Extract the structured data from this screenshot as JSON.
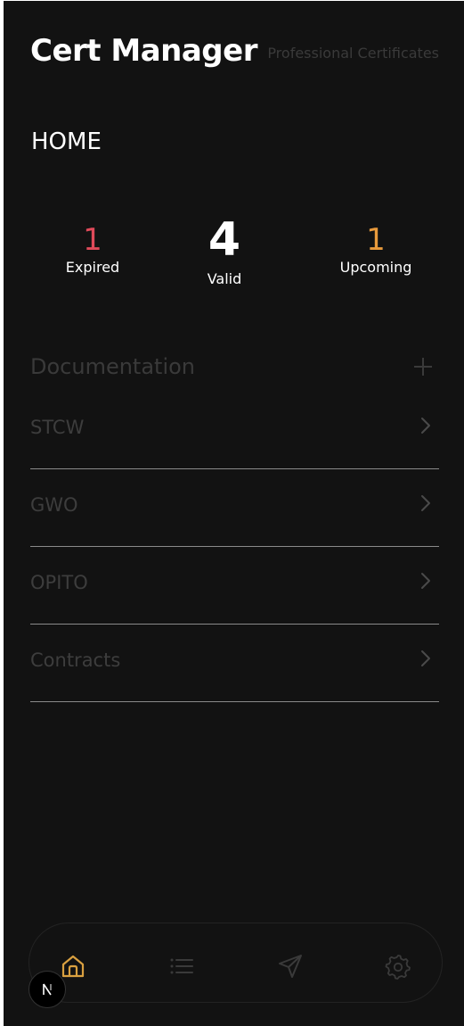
{
  "header": {
    "title": "Cert Manager",
    "subtitle": "Professional Certificates"
  },
  "page": {
    "title": "HOME"
  },
  "stats": {
    "expired": {
      "value": "1",
      "label": "Expired",
      "color": "#e04a5a"
    },
    "valid": {
      "value": "4",
      "label": "Valid",
      "color": "#ffffff"
    },
    "upcoming": {
      "value": "1",
      "label": "Upcoming",
      "color": "#e89a3c"
    }
  },
  "documentation": {
    "title": "Documentation",
    "add_icon": "plus-icon",
    "items": [
      {
        "label": "STCW",
        "icon": "chevron-right-icon"
      },
      {
        "label": "GWO",
        "icon": "chevron-right-icon"
      },
      {
        "label": "OPITO",
        "icon": "chevron-right-icon"
      },
      {
        "label": "Contracts",
        "icon": "chevron-right-icon"
      }
    ]
  },
  "bottom_nav": {
    "items": [
      {
        "name": "home",
        "icon": "home-icon",
        "active": true,
        "color": "#d9a040"
      },
      {
        "name": "list",
        "icon": "list-icon",
        "active": false,
        "color": "#3a3a3a"
      },
      {
        "name": "send",
        "icon": "send-icon",
        "active": false,
        "color": "#3a3a3a"
      },
      {
        "name": "settings",
        "icon": "gear-icon",
        "active": false,
        "color": "#3a3a3a"
      }
    ]
  },
  "colors": {
    "background": "#121212",
    "accent": "#d9a040",
    "muted": "#3a3a3a"
  }
}
